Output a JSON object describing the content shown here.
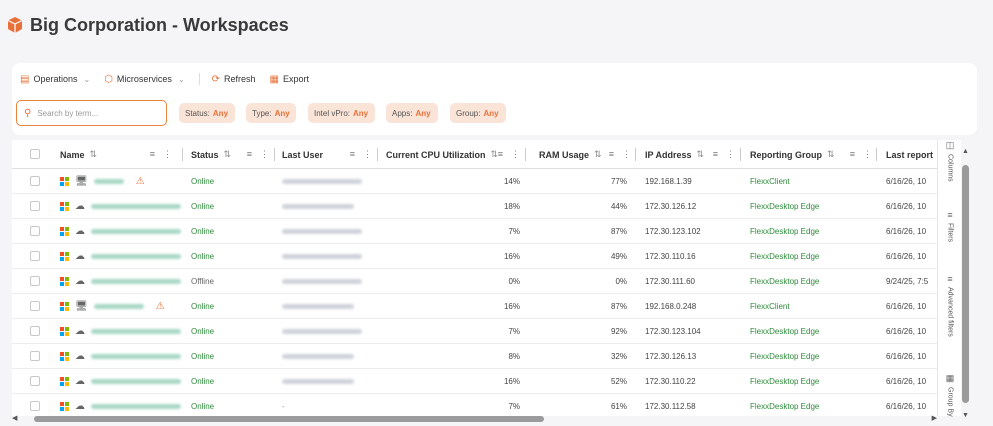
{
  "page": {
    "title": "Big Corporation - Workspaces"
  },
  "colors": {
    "accent": "#e8713a",
    "online": "#2e8b3a",
    "chip_bg": "#fae3d7"
  },
  "toolbar": {
    "operations_label": "Operations",
    "microservices_label": "Microservices",
    "refresh_label": "Refresh",
    "export_label": "Export"
  },
  "search": {
    "placeholder": "Search by term..."
  },
  "filters": [
    {
      "label": "Status:",
      "value": "Any"
    },
    {
      "label": "Type:",
      "value": "Any"
    },
    {
      "label": "Intel vPro:",
      "value": "Any"
    },
    {
      "label": "Apps:",
      "value": "Any"
    },
    {
      "label": "Group:",
      "value": "Any"
    }
  ],
  "table": {
    "columns": [
      "Name",
      "Status",
      "Last User",
      "Current CPU Utilization",
      "RAM Usage",
      "IP Address",
      "Reporting Group",
      "Last report"
    ],
    "rows": [
      {
        "device": "desktop",
        "warning": true,
        "status": "Online",
        "cpu": "14%",
        "ram": "77%",
        "ip": "192.168.1.39",
        "group": "FlexxClient",
        "last_report": "6/16/26, 10"
      },
      {
        "device": "cloud",
        "warning": false,
        "status": "Online",
        "cpu": "18%",
        "ram": "44%",
        "ip": "172.30.126.12",
        "group": "FlexxDesktop Edge",
        "last_report": "6/16/26, 10"
      },
      {
        "device": "cloud",
        "warning": false,
        "status": "Online",
        "cpu": "7%",
        "ram": "87%",
        "ip": "172.30.123.102",
        "group": "FlexxDesktop Edge",
        "last_report": "6/16/26, 10"
      },
      {
        "device": "cloud",
        "warning": false,
        "status": "Online",
        "cpu": "16%",
        "ram": "49%",
        "ip": "172.30.110.16",
        "group": "FlexxDesktop Edge",
        "last_report": "6/16/26, 10"
      },
      {
        "device": "cloud",
        "warning": false,
        "status": "Offline",
        "cpu": "0%",
        "ram": "0%",
        "ip": "172.30.111.60",
        "group": "FlexxDesktop Edge",
        "last_report": "9/24/25, 7:5"
      },
      {
        "device": "desktop",
        "warning": true,
        "status": "Online",
        "cpu": "16%",
        "ram": "87%",
        "ip": "192.168.0.248",
        "group": "FlexxClient",
        "last_report": "6/16/26, 10"
      },
      {
        "device": "cloud",
        "warning": false,
        "status": "Online",
        "cpu": "7%",
        "ram": "92%",
        "ip": "172.30.123.104",
        "group": "FlexxDesktop Edge",
        "last_report": "6/16/26, 10"
      },
      {
        "device": "cloud",
        "warning": false,
        "status": "Online",
        "cpu": "8%",
        "ram": "32%",
        "ip": "172.30.126.13",
        "group": "FlexxDesktop Edge",
        "last_report": "6/16/26, 10"
      },
      {
        "device": "cloud",
        "warning": false,
        "status": "Online",
        "cpu": "16%",
        "ram": "52%",
        "ip": "172.30.110.22",
        "group": "FlexxDesktop Edge",
        "last_report": "6/16/26, 10"
      },
      {
        "device": "cloud",
        "warning": false,
        "status": "Online",
        "cpu": "7%",
        "ram": "61%",
        "ip": "172.30.112.58",
        "group": "FlexxDesktop Edge",
        "last_report": "6/16/26, 10"
      }
    ],
    "last_user_placeholder": "-"
  },
  "side_panel": {
    "columns_label": "Columns",
    "filters_label": "Filters",
    "advanced_filters_label": "Advanced filters",
    "group_by_label": "Group By"
  }
}
